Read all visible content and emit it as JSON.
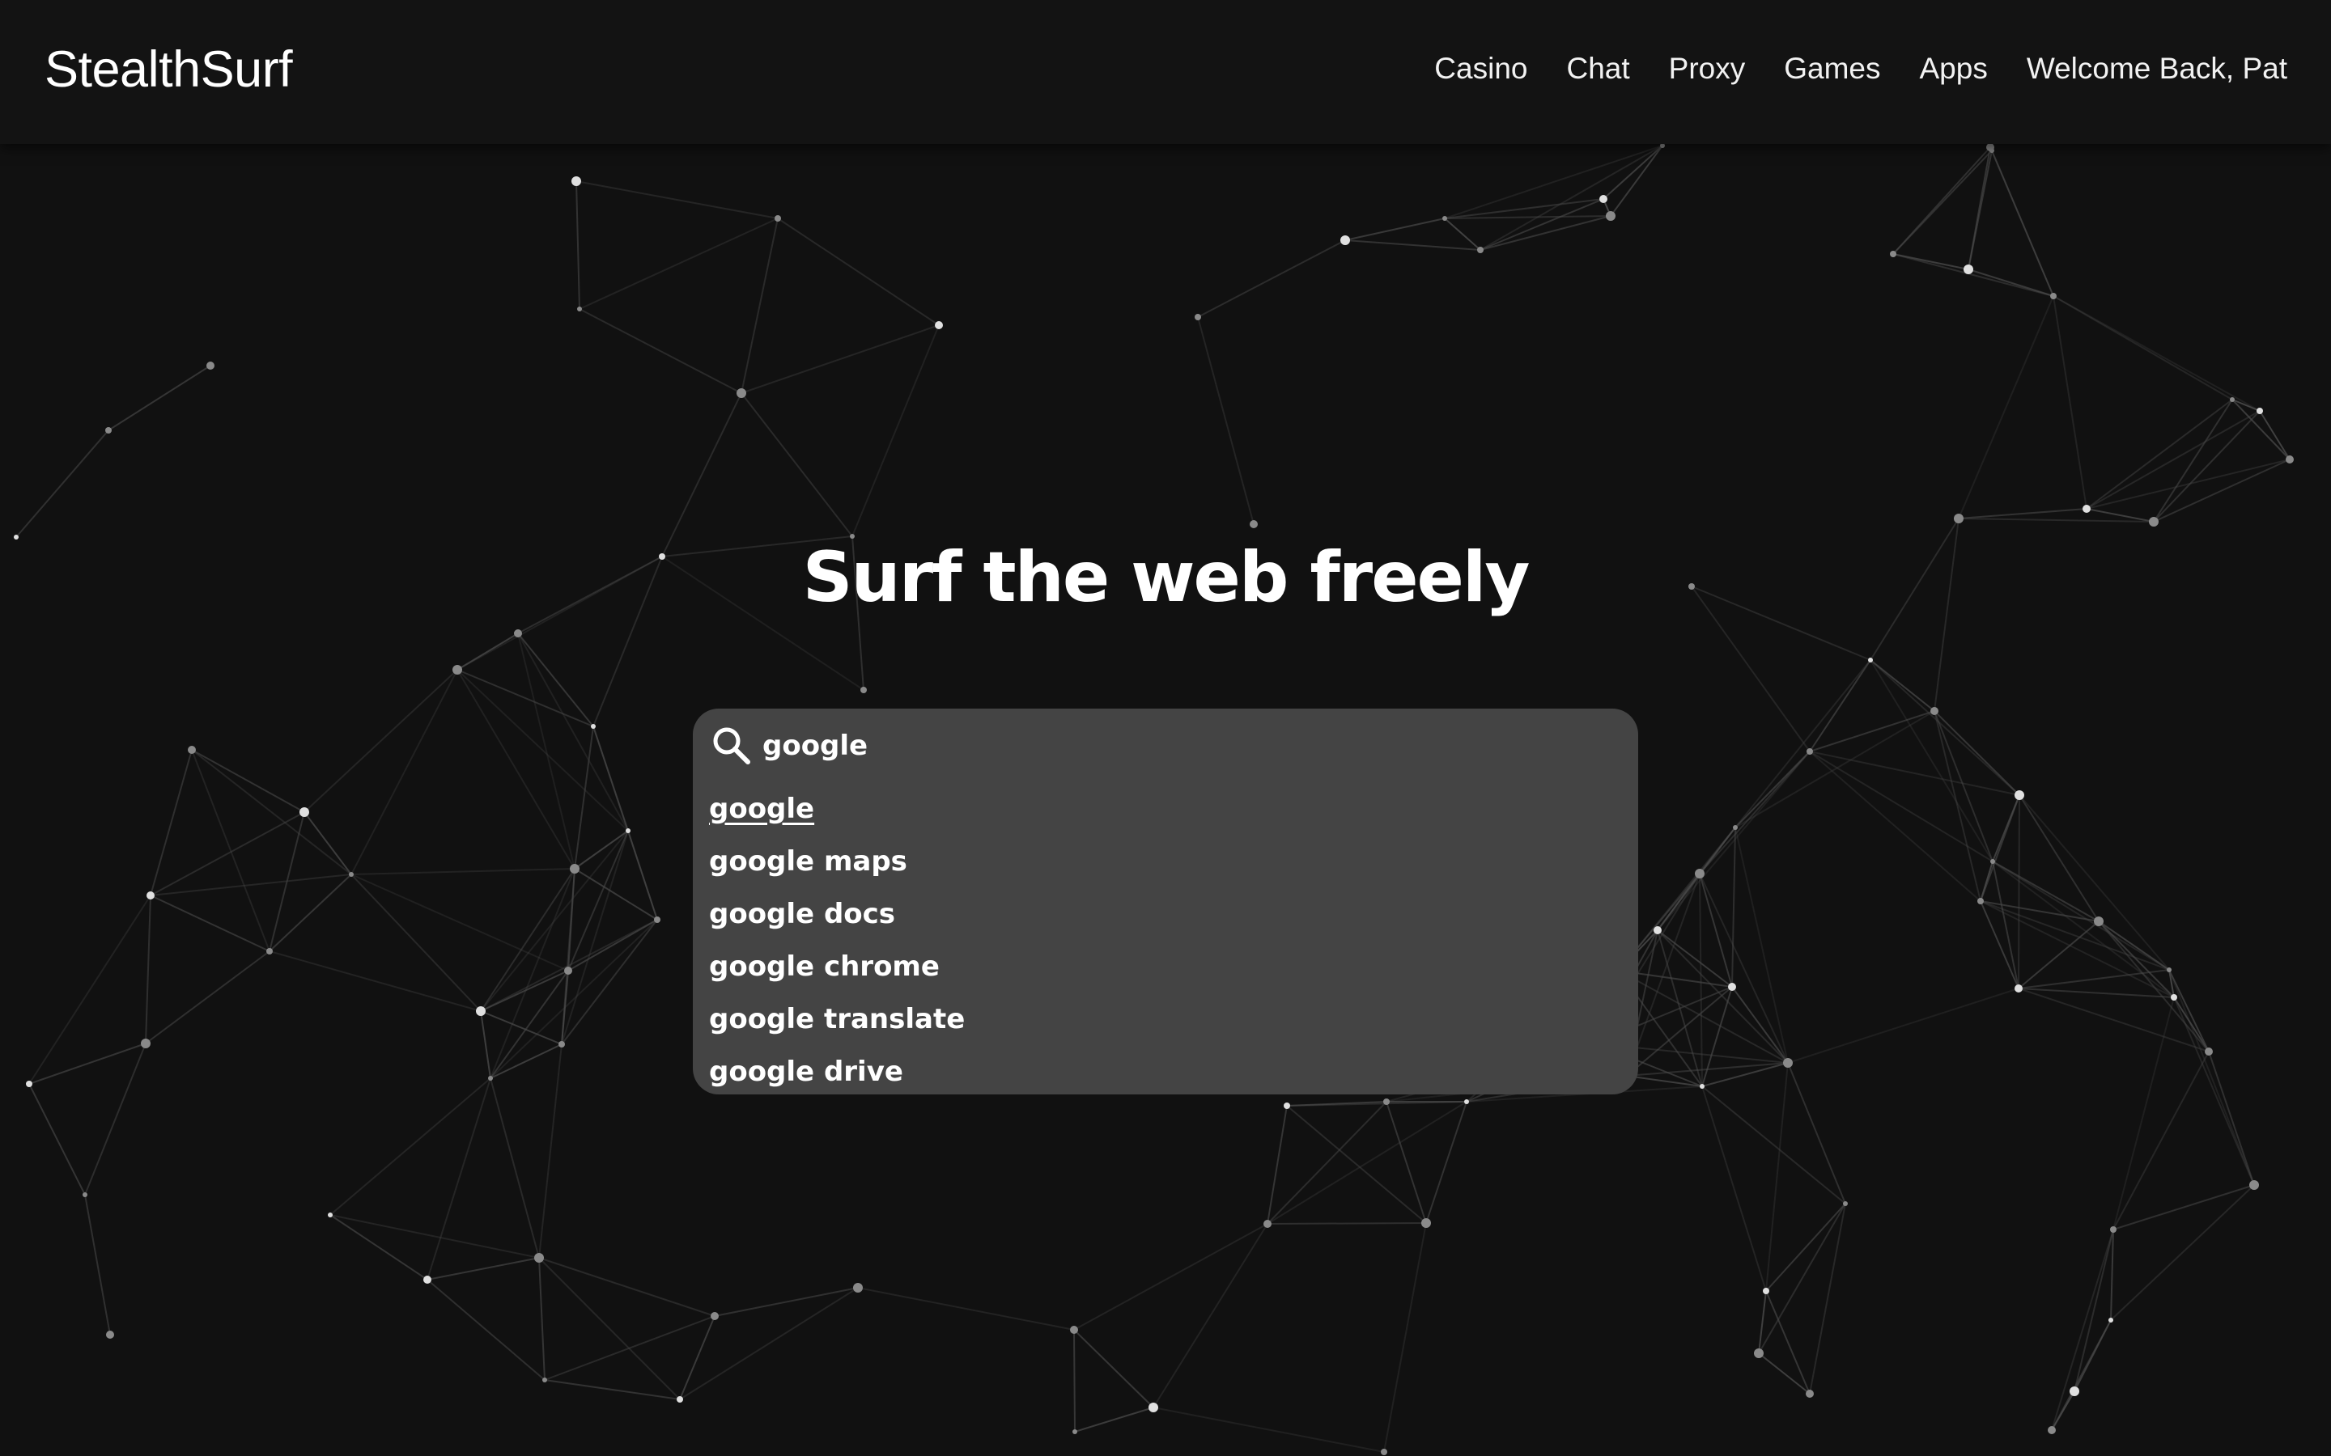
{
  "header": {
    "brand": "StealthSurf",
    "nav": [
      {
        "label": "Casino"
      },
      {
        "label": "Chat"
      },
      {
        "label": "Proxy"
      },
      {
        "label": "Games"
      },
      {
        "label": "Apps"
      },
      {
        "label": "Welcome Back, Pat"
      }
    ]
  },
  "hero": {
    "title": "Surf the web freely"
  },
  "search": {
    "value": "google",
    "icon": "search-icon",
    "suggestions": [
      {
        "label": "google"
      },
      {
        "label": "google maps"
      },
      {
        "label": "google docs"
      },
      {
        "label": "google chrome"
      },
      {
        "label": "google translate"
      },
      {
        "label": "google drive"
      }
    ]
  },
  "colors": {
    "background": "#111111",
    "topbar": "#131313",
    "search_box": "#444444",
    "text": "#ffffff",
    "network_line": "#3a3a3a",
    "network_node": "#bbbbbb"
  }
}
